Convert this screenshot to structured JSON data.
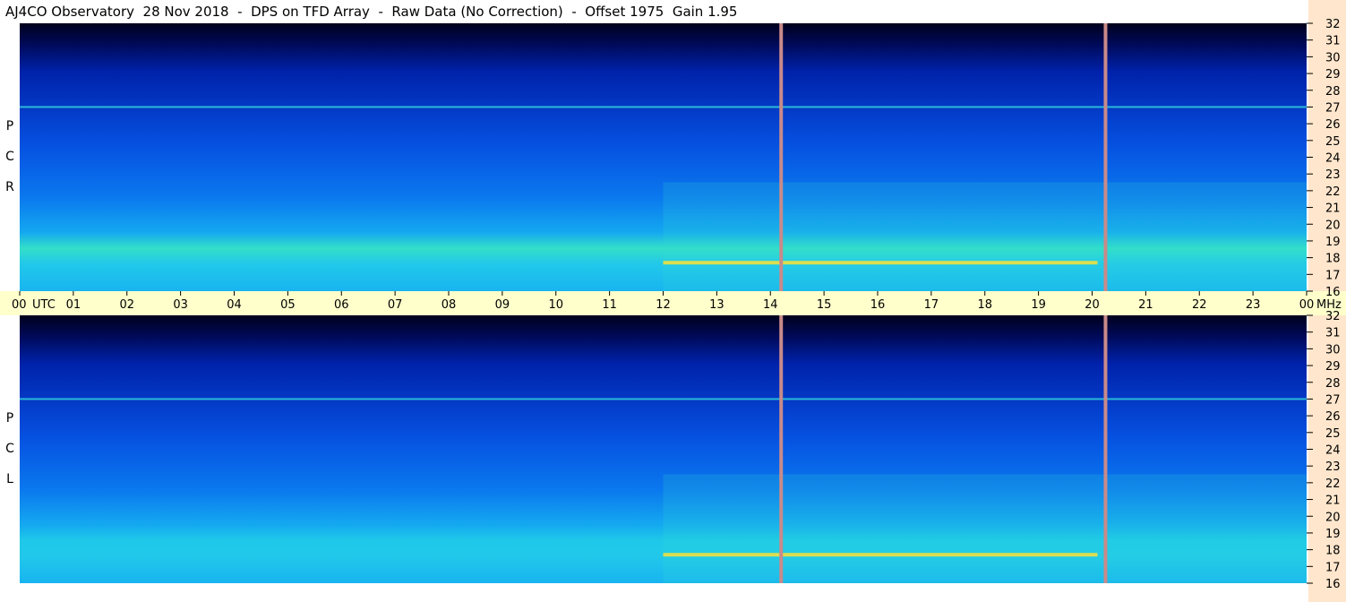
{
  "title": "AJ4CO Observatory  28 Nov 2018  -  DPS on TFD Array  -  Raw Data (No Correction)  -  Offset 1975  Gain 1.95",
  "panels": [
    {
      "id": "rcp",
      "label": [
        "R",
        "C",
        "P"
      ]
    },
    {
      "id": "lcp",
      "label": [
        "L",
        "C",
        "P"
      ]
    }
  ],
  "colors": {
    "time_bar": "#ffffcc",
    "freq_bar": "#ffe6cc",
    "marker_line": "#c88a8a",
    "background_top": "#00001a",
    "background_bottom": "#1aa0e6"
  },
  "chart_data": {
    "type": "heatmap",
    "title": "AJ4CO Observatory  28 Nov 2018  -  DPS on TFD Array  -  Raw Data (No Correction)  -  Offset 1975  Gain 1.95",
    "x_axis": {
      "unit_label": "UTC",
      "tick_labels": [
        "00",
        "01",
        "02",
        "03",
        "04",
        "05",
        "06",
        "07",
        "08",
        "09",
        "10",
        "11",
        "12",
        "13",
        "14",
        "15",
        "16",
        "17",
        "18",
        "19",
        "20",
        "21",
        "22",
        "23",
        "00"
      ],
      "range": [
        0,
        24
      ]
    },
    "y_axis": {
      "unit_label": "MHz",
      "tick_labels": [
        "16",
        "17",
        "18",
        "19",
        "20",
        "21",
        "22",
        "23",
        "24",
        "25",
        "26",
        "27",
        "28",
        "29",
        "30",
        "31",
        "32"
      ],
      "range": [
        16,
        32
      ]
    },
    "marker_times_utc": [
      14.2,
      20.25
    ],
    "features": [
      {
        "panel": "RCP",
        "freq_mhz": 27,
        "time_utc": [
          0,
          24
        ],
        "note": "narrowband interference line"
      },
      {
        "panel": "RCP",
        "freq_mhz": 17.7,
        "time_utc": [
          12,
          20.1
        ],
        "note": "strong interference"
      },
      {
        "panel": "LCP",
        "freq_mhz": 27,
        "time_utc": [
          0,
          24
        ],
        "note": "narrowband interference line"
      },
      {
        "panel": "LCP",
        "freq_mhz": 17.7,
        "time_utc": [
          12,
          20.1
        ],
        "note": "strong interference"
      }
    ]
  }
}
